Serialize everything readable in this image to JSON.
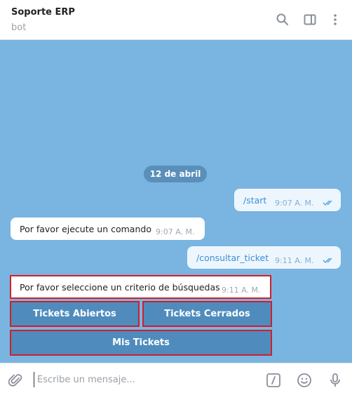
{
  "header": {
    "title": "Soporte ERP",
    "subtitle": "bot",
    "icons": [
      "search-icon",
      "sidebar-toggle-icon",
      "more-vert-icon"
    ]
  },
  "chat": {
    "date_label": "12 de abril",
    "messages": [
      {
        "text": "/start",
        "time": "9:07 A. M.",
        "direction": "out",
        "read": true
      },
      {
        "text": "Por favor ejecute un comando",
        "time": "9:07 A. M.",
        "direction": "in"
      },
      {
        "text": "/consultar_ticket",
        "time": "9:11 A. M.",
        "direction": "out",
        "read": true
      },
      {
        "text": "Por favor seleccione un criterio de búsquedas",
        "time": "9:11 A. M.",
        "direction": "in"
      }
    ],
    "keyboard": {
      "buttons": [
        "Tickets Abiertos",
        "Tickets Cerrados",
        "Mis Tickets"
      ]
    }
  },
  "composer": {
    "placeholder": "Escribe un mensaje...",
    "icons": [
      "paperclip-icon",
      "bot-commands-icon",
      "emoji-icon",
      "microphone-icon"
    ]
  },
  "colors": {
    "chat_background": "#7ab4e0",
    "outgoing_bubble": "#eef6fd",
    "keyboard_button": "#4f8cbd",
    "highlight_border": "#d11e2a"
  }
}
